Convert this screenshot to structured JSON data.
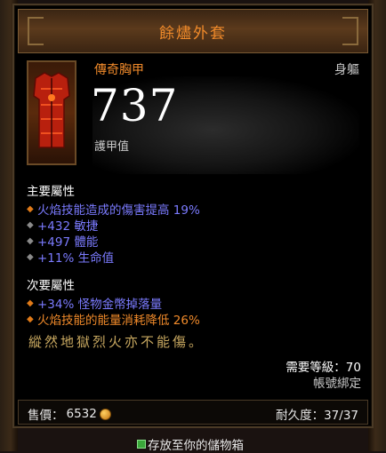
{
  "item": {
    "name": "餘燼外套",
    "quality": "傳奇胸甲",
    "slot": "身軀",
    "armor": "737",
    "armor_label": "護甲值",
    "primary_header": "主要屬性",
    "primary_props": [
      {
        "text": "火焰技能造成的傷害提高 19%",
        "color": "blue",
        "bullet": "orange"
      },
      {
        "text": "+432 敏捷",
        "color": "blue",
        "bullet": "grey"
      },
      {
        "text": "+497 體能",
        "color": "blue",
        "bullet": "grey"
      },
      {
        "text": "+11% 生命值",
        "color": "blue",
        "bullet": "grey"
      }
    ],
    "secondary_header": "次要屬性",
    "secondary_props": [
      {
        "text": "+34% 怪物金幣掉落量",
        "color": "blue",
        "bullet": "orange"
      },
      {
        "text": "火焰技能的能量消耗降低 26%",
        "color": "orange",
        "bullet": "orange"
      }
    ],
    "flavor": "縱然地獄烈火亦不能傷。",
    "required_level": "需要等級：70",
    "binding": "帳號綁定",
    "price_label": "售價：",
    "price_value": "6532",
    "durability": "耐久度：37/37"
  },
  "stash_hint": "存放至你的儲物箱",
  "colors": {
    "legendary": "#f08a2a",
    "magic": "#7b7bff",
    "flavor": "#c8a860"
  }
}
